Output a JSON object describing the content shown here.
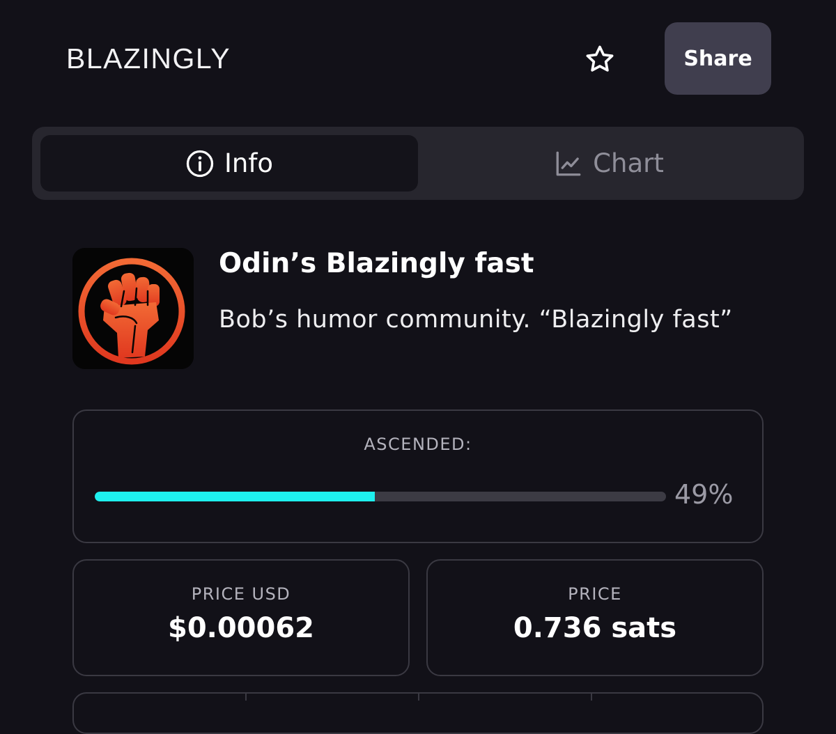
{
  "header": {
    "title": "BLAZINGLY",
    "favorite_icon": "star-icon",
    "share_label": "Share"
  },
  "tabs": [
    {
      "label": "Info",
      "icon": "info-icon",
      "active": true
    },
    {
      "label": "Chart",
      "icon": "chart-icon",
      "active": false
    }
  ],
  "token": {
    "logo_icon": "raised-fist-icon",
    "name": "Odin’s Blazingly fast",
    "description": "Bob’s humor community. “Blazingly fast”"
  },
  "ascended": {
    "label": "ASCENDED:",
    "percent": 49,
    "percent_text": "49%",
    "fill_color": "#1ef0ee"
  },
  "prices": {
    "usd_label": "PRICE USD",
    "usd_value": "$0.00062",
    "sats_label": "PRICE",
    "sats_value": "0.736 sats"
  },
  "colors": {
    "background": "#121118",
    "accent": "#1ef0ee",
    "logo_orange": "#e8452a"
  }
}
